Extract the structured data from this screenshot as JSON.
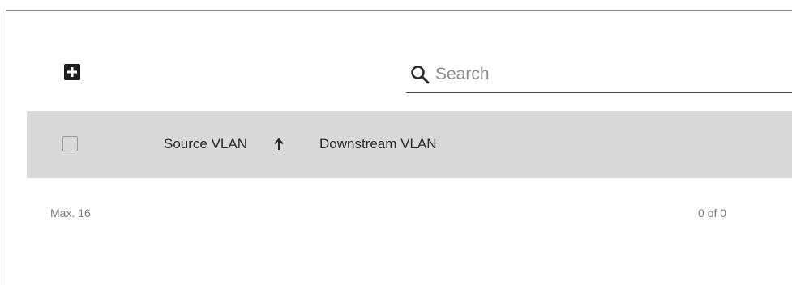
{
  "toolbar": {
    "add_icon": "plus-square-icon",
    "search": {
      "icon": "search-icon",
      "placeholder": "Search",
      "value": ""
    }
  },
  "table": {
    "select_all_checked": false,
    "columns": [
      {
        "label": "Source VLAN",
        "sort": "ascending",
        "sort_icon": "arrow-up-icon"
      },
      {
        "label": "Downstream VLAN"
      }
    ],
    "rows": []
  },
  "footer": {
    "max_label": "Max. 16",
    "page_info": "0 of 0"
  },
  "colors": {
    "header_background": "#d9d9d9",
    "icon_dark": "#1f1f1f"
  }
}
